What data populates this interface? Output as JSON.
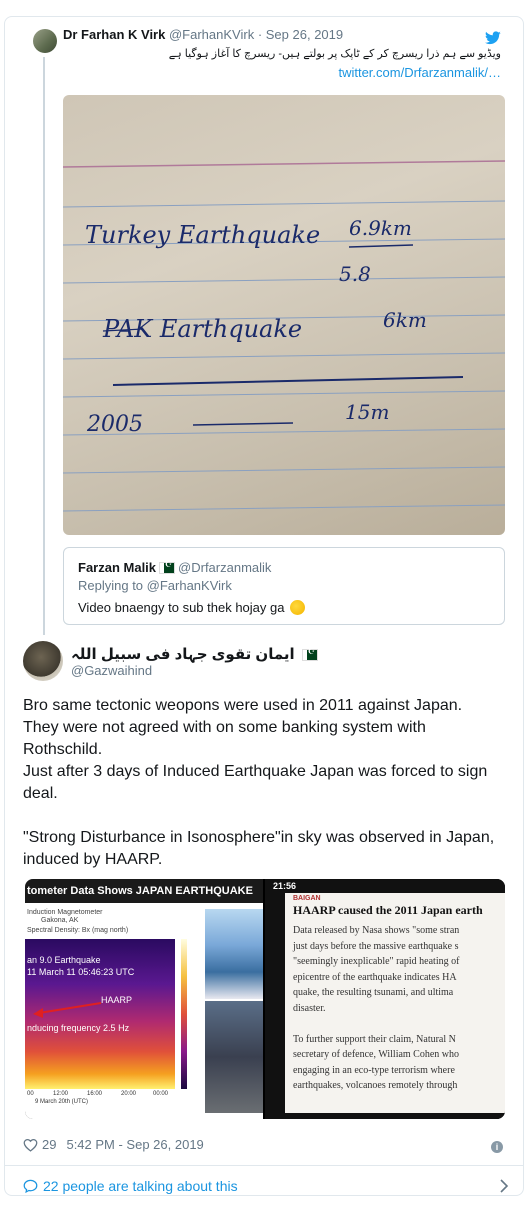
{
  "parent_tweet": {
    "name": "Dr Farhan K Virk",
    "handle": "@FarhanKVirk",
    "separator": " · ",
    "date": "Sep 26, 2019",
    "text_urdu": "ویڈیو سے ہم ذرا ریسرچ کر کے ٹاپک پر بولتے ہیں- ریسرچ کا آغاز ہوگیا ہے",
    "link": "twitter.com/Drfarzanmalik/…",
    "note": {
      "line1": "Turkey Earthquake",
      "line1_value": "6.9km",
      "line2_value": "5.8",
      "line3": "PAK Earthquake",
      "line3_value": "6km",
      "line4": "2005",
      "line4_value": "15m"
    }
  },
  "quoted_tweet": {
    "name": "Farzan Malik",
    "handle": "@Drfarzanmalik",
    "replying": "Replying to @FarhanKVirk",
    "text": "Video bnaengy to sub thek hojay ga"
  },
  "main_tweet": {
    "name_urdu": "ایمان تقوی جہاد فی سبیل اللہ",
    "handle": "@Gazwaihind",
    "lines": [
      "Bro same tectonic weopons were used in 2011 against Japan.",
      "They were not agreed with on some banking system with",
      "Rothschild.",
      "Just after 3 days of Induced Earthquake Japan was forced to sign",
      "deal.",
      "",
      "\"Strong Disturbance in Isonosphere\"in sky was observed in Japan,",
      "induced by HAARP."
    ],
    "likes": "29",
    "time": "5:42 PM - Sep 26, 2019",
    "talking": "22 people are talking about this"
  },
  "media_left": {
    "title": "tometer Data Shows JAPAN EARTHQUAKE",
    "meta1": "Induction Magnetometer",
    "meta2": "Gakona, AK",
    "meta3": "Spectral Density: Bx (mag north)",
    "spec1": "an 9.0 Earthquake",
    "spec2": "11 March 11 05:46:23 UTC",
    "haarp": "HAARP",
    "freq": "nducing frequency 2.5 Hz",
    "axis_date": "9 March 20th (UTC)",
    "ticks": [
      "00",
      "12:00",
      "16:00",
      "20:00",
      "00:00"
    ]
  },
  "media_right": {
    "status": "21:56",
    "badge": "BAIGAN",
    "title": "HAARP caused the 2011 Japan earth",
    "title_prefix": "HA",
    "body": [
      "Data released by Nasa shows \"some stran",
      "just days before the massive earthquake s",
      "\"seemingly inexplicable\" rapid heating of",
      "epicentre of the earthquake indicates HA",
      "quake, the resulting tsunami, and ultima",
      "disaster.",
      "",
      "To further support their claim, Natural N",
      "secretary of defence, William Cohen who",
      "engaging in an eco-type terrorism where",
      "earthquakes, volcanoes remotely through"
    ]
  },
  "colors": {
    "link": "#1b95e0",
    "secondary": "#657786",
    "border": "#e1e8ed"
  }
}
